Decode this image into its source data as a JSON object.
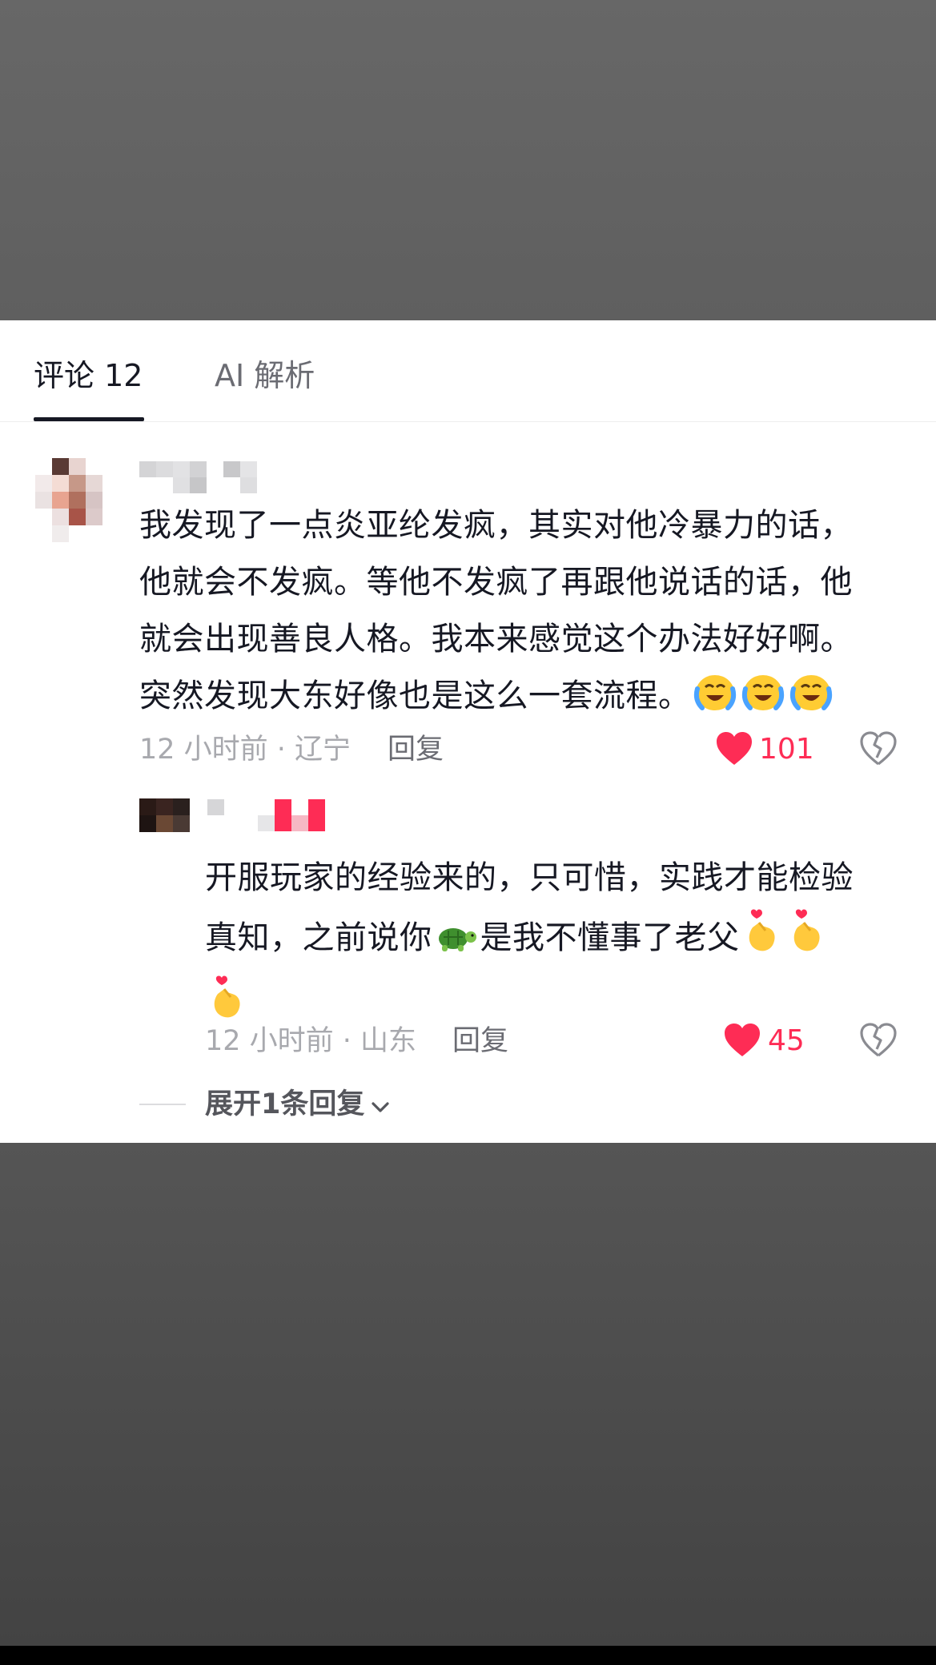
{
  "tabs": {
    "comments_label": "评论 12",
    "ai_label": "AI 解析"
  },
  "comment": {
    "lines": [
      "我发现了一点炎亚纶发疯，其实对他冷暴力的话，",
      "他就会不发疯。等他不发疯了再跟他说话的话，他",
      "就会出现善良人格。我本来感觉这个办法好好啊。",
      "突然发现大东好像也是这么一套流程。"
    ],
    "emoji_names": [
      "crying-laughing-emoji",
      "crying-laughing-emoji",
      "crying-laughing-emoji"
    ],
    "time_location": "12 小时前 · 辽宁",
    "reply_label": "回复",
    "likes": "101"
  },
  "reply": {
    "line1": "开服玩家的经验来的，只可惜，实践才能检验",
    "line2_before": "真知，之前说你",
    "line2_after": "是我不懂事了老父",
    "emoji_names": [
      "turtle-emoji",
      "finger-heart-emoji",
      "finger-heart-emoji",
      "finger-heart-emoji"
    ],
    "time_location": "12 小时前 · 山东",
    "reply_label": "回复",
    "likes": "45"
  },
  "expand": {
    "label": "展开1条回复"
  },
  "colors": {
    "like_red": "#fe2c55",
    "text_primary": "#161823",
    "text_meta": "#a8a9ae"
  }
}
